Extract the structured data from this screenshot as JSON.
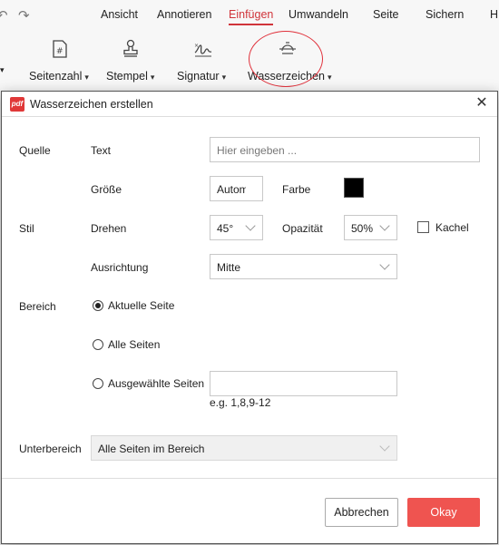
{
  "menu": {
    "items": [
      "Ansicht",
      "Annotieren",
      "Einfügen",
      "Umwandeln",
      "Seite",
      "Sichern",
      "H"
    ],
    "active": "Einfügen"
  },
  "ribbon": {
    "tools": [
      {
        "label": "Seitenzahl",
        "icon": "page-number-icon"
      },
      {
        "label": "Stempel",
        "icon": "stamp-icon"
      },
      {
        "label": "Signatur",
        "icon": "signature-icon"
      },
      {
        "label": "Wasserzeichen",
        "icon": "watermark-icon"
      }
    ],
    "highlight_color": "#e0303a"
  },
  "dialog": {
    "title": "Wasserzeichen erstellen",
    "sections": {
      "source": "Quelle",
      "style": "Stil",
      "range": "Bereich",
      "subrange": "Unterbereich"
    },
    "text": {
      "label": "Text",
      "placeholder": "Hier eingeben ..."
    },
    "size": {
      "label": "Größe",
      "value": "Automatisch"
    },
    "color": {
      "label": "Farbe",
      "value": "#000000"
    },
    "rotate": {
      "label": "Drehen",
      "value": "45°"
    },
    "opacity": {
      "label": "Opazität",
      "value": "50%"
    },
    "tile": {
      "label": "Kachel",
      "checked": false
    },
    "alignment": {
      "label": "Ausrichtung",
      "value": "Mitte"
    },
    "range": {
      "current_page": "Aktuelle Seite",
      "all_pages": "Alle Seiten",
      "selected_pages": "Ausgewählte Seiten",
      "selected_hint": "e.g. 1,8,9-12",
      "selected": "current_page"
    },
    "subrange_value": "Alle Seiten im Bereich",
    "buttons": {
      "cancel": "Abbrechen",
      "ok": "Okay"
    },
    "accent": "#ef5450"
  }
}
